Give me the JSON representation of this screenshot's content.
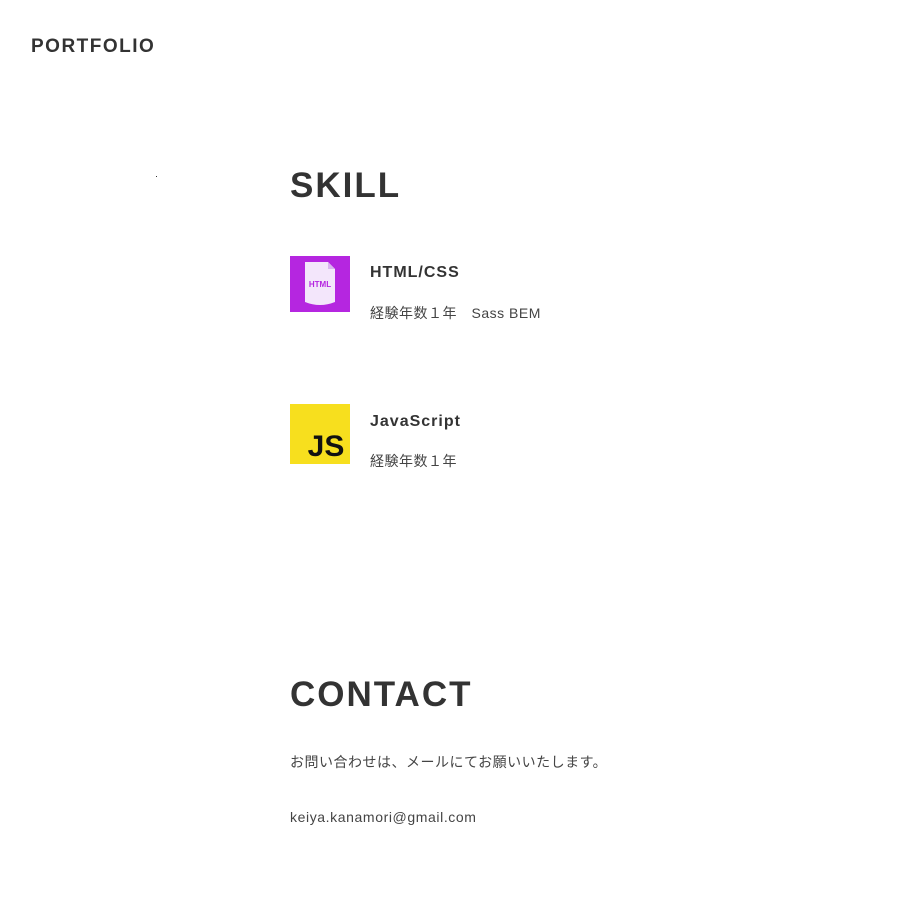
{
  "header": {
    "logo_text": "PORTFOLIO"
  },
  "skill": {
    "title": "SKILL",
    "items": [
      {
        "name": "HTML/CSS",
        "description": "経験年数１年　Sass BEM",
        "icon": "html-file-icon",
        "icon_label": "HTML",
        "icon_color": "#b526e0"
      },
      {
        "name": "JavaScript",
        "description": "経験年数１年",
        "icon": "javascript-logo-icon",
        "icon_label": "JS",
        "icon_color": "#f7df1e"
      }
    ]
  },
  "contact": {
    "title": "CONTACT",
    "message": "お問い合わせは、メールにてお願いいたします。",
    "email": "keiya.kanamori@gmail.com"
  },
  "colors": {
    "text": "#333333",
    "background": "#ffffff"
  }
}
